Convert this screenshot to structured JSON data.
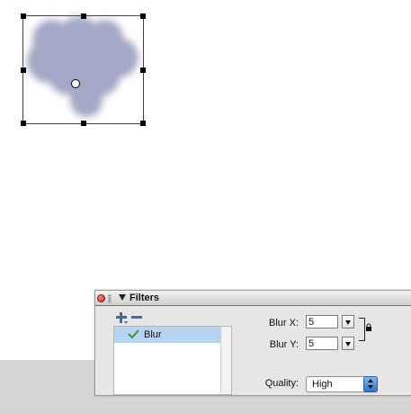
{
  "canvas": {
    "object": {
      "icon": "blurred-cloud-shape",
      "fill_color": "#a3a8c4"
    }
  },
  "filters_panel": {
    "title": "Filters",
    "icons": {
      "close": "close-icon",
      "collapse": "triangle-down-icon",
      "add": "add-filter-icon",
      "remove": "remove-filter-icon",
      "check": "check-icon",
      "lock": "lock-icon"
    },
    "filters": [
      {
        "name": "Blur",
        "enabled": true
      }
    ],
    "properties": {
      "blur_x": {
        "label": "Blur X:",
        "value": "5"
      },
      "blur_y": {
        "label": "Blur Y:",
        "value": "5"
      },
      "quality": {
        "label": "Quality:",
        "value": "High"
      }
    },
    "colors": {
      "header_accent": "#4a7aa7",
      "selected_row": "#b7d4f2",
      "check_green": "#2ea12e"
    }
  }
}
